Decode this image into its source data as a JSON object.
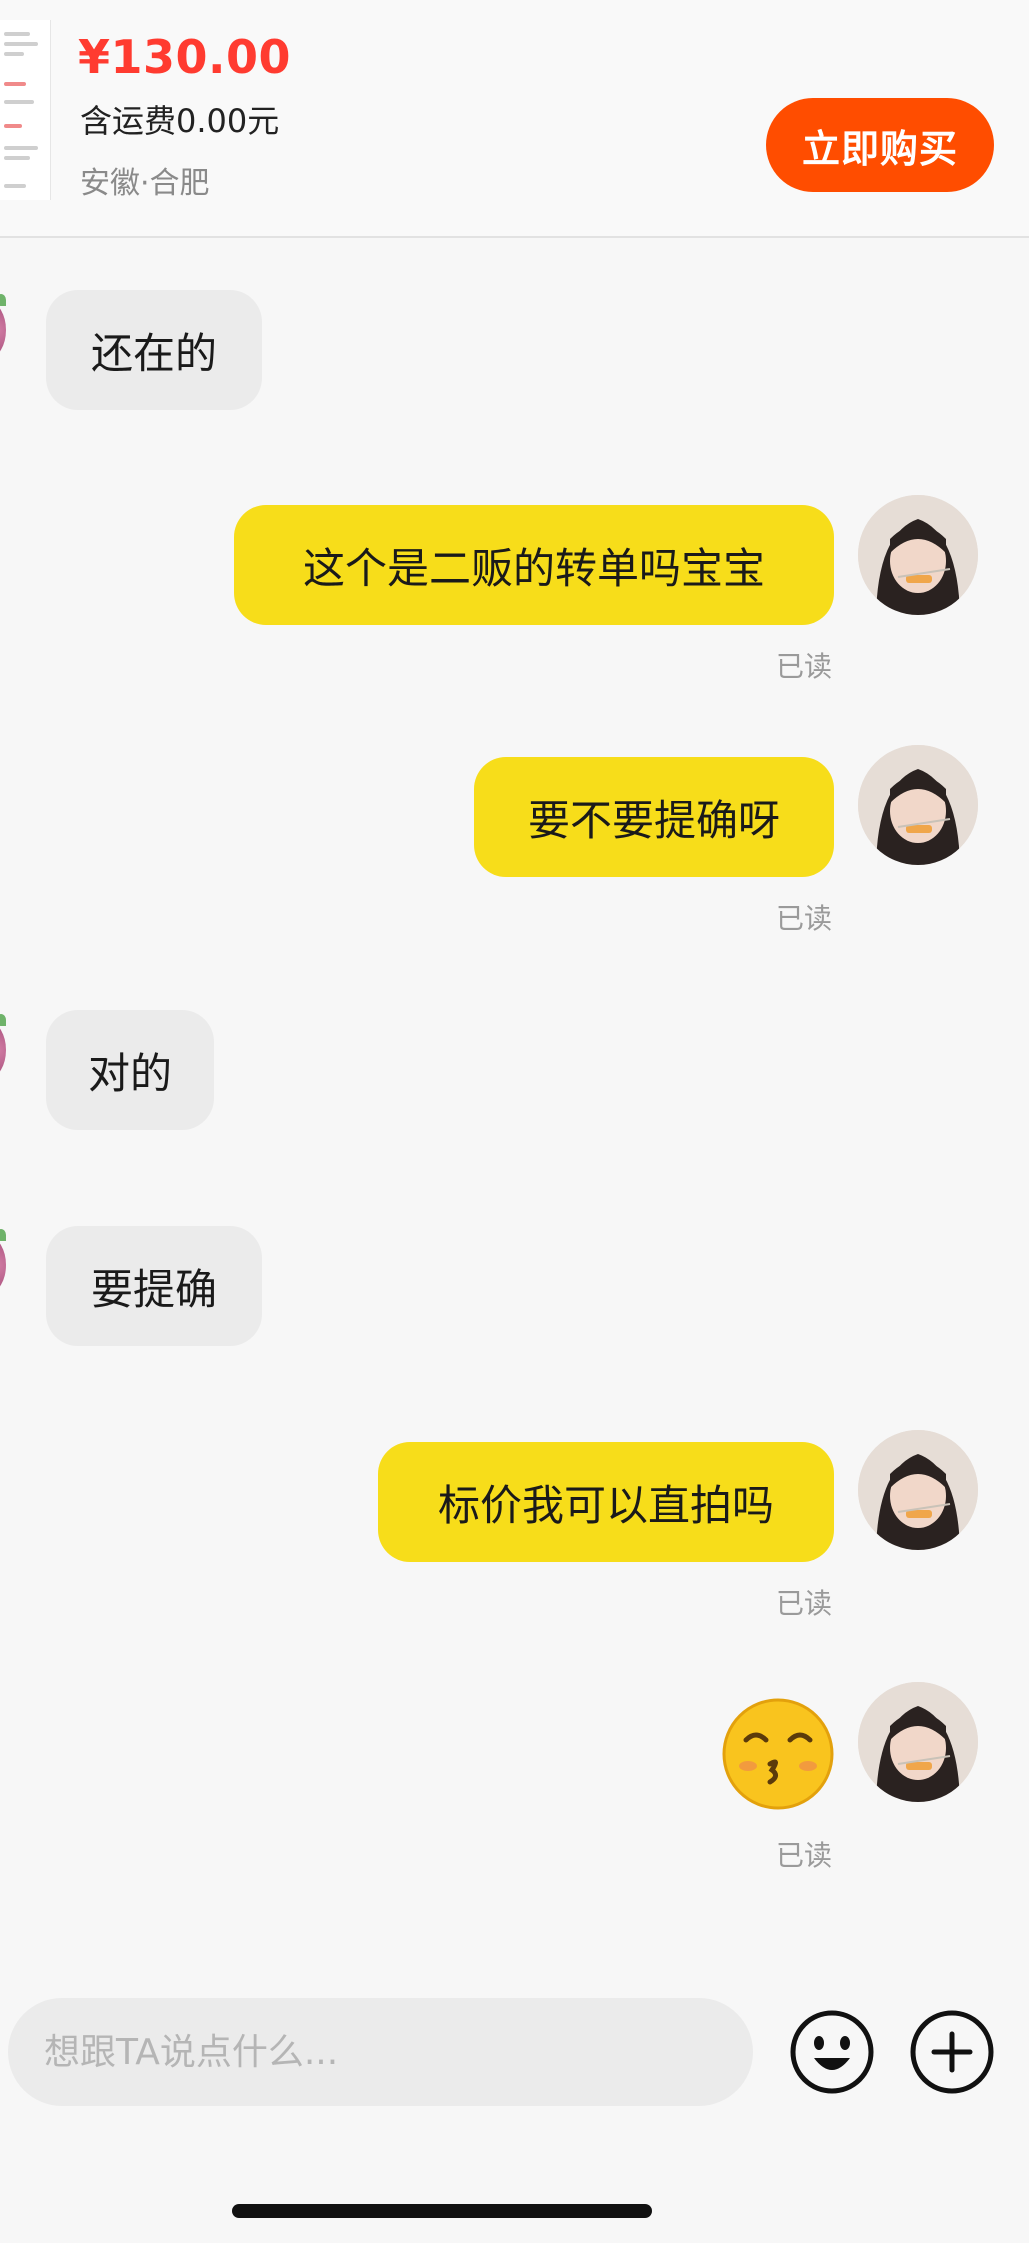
{
  "product": {
    "price": "¥130.00",
    "shipping": "含运费0.00元",
    "location": "安徽·合肥",
    "buy_label": "立即购买"
  },
  "messages": [
    {
      "side": "incoming",
      "text": "还在的"
    },
    {
      "side": "outgoing",
      "text": "这个是二贩的转单吗宝宝",
      "status": "已读"
    },
    {
      "side": "outgoing",
      "text": "要不要提确呀",
      "status": "已读"
    },
    {
      "side": "incoming",
      "text": "对的"
    },
    {
      "side": "incoming",
      "text": "要提确"
    },
    {
      "side": "outgoing",
      "text": "标价我可以直拍吗",
      "status": "已读"
    },
    {
      "side": "outgoing",
      "sticker": "kissing-face-emoji",
      "status": "已读"
    }
  ],
  "composer": {
    "placeholder": "想跟TA说点什么...",
    "emoji_icon": "smiley-face-icon",
    "add_icon": "plus-circle-icon"
  },
  "colors": {
    "price": "#ff3b30",
    "buy_button": "#ff4d00",
    "outgoing_bubble": "#f7dd1a",
    "incoming_bubble": "#ebebeb"
  }
}
